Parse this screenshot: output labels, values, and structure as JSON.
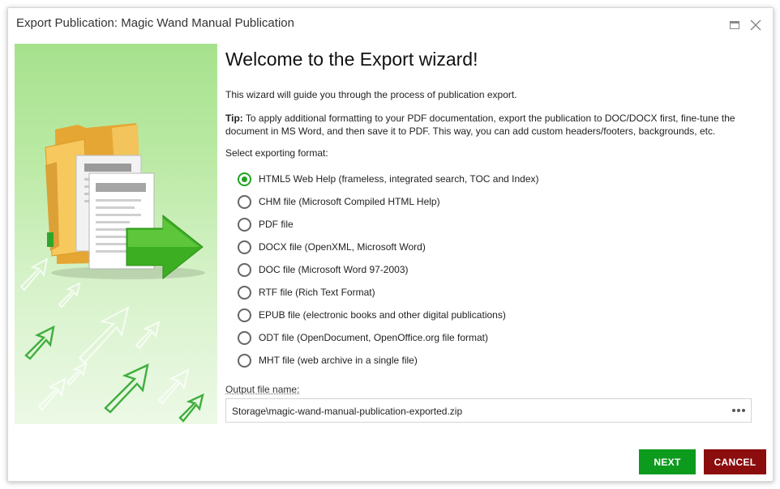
{
  "window": {
    "title": "Export Publication: Magic Wand Manual Publication"
  },
  "icons": {
    "maximize": "maximize-icon",
    "close": "close-icon",
    "browse": "ellipsis-icon",
    "illustration": "folder-export-illustration"
  },
  "wizard": {
    "heading": "Welcome to the Export wizard!",
    "intro": "This wizard will guide you through the process of publication export.",
    "tip_label": "Tip:",
    "tip_text": " To apply additional formatting to your PDF documentation, export the publication to DOC/DOCX first, fine-tune the document in MS Word, and then save it to PDF. This way, you can add custom headers/footers, backgrounds, etc.",
    "format_label": "Select exporting format:",
    "formats": [
      {
        "label": "HTML5 Web Help (frameless, integrated search, TOC and Index)",
        "selected": true
      },
      {
        "label": "CHM file (Microsoft Compiled HTML Help)",
        "selected": false
      },
      {
        "label": "PDF file",
        "selected": false
      },
      {
        "label": "DOCX file (OpenXML, Microsoft Word)",
        "selected": false
      },
      {
        "label": "DOC file (Microsoft Word 97-2003)",
        "selected": false
      },
      {
        "label": "RTF file (Rich Text Format)",
        "selected": false
      },
      {
        "label": "EPUB file (electronic books and other digital publications)",
        "selected": false
      },
      {
        "label": "ODT file (OpenDocument, OpenOffice.org file format)",
        "selected": false
      },
      {
        "label": "MHT file (web archive in a single file)",
        "selected": false
      }
    ],
    "output_label": "Output file name:",
    "output_value": "Storage\\magic-wand-manual-publication-exported.zip"
  },
  "buttons": {
    "next": "NEXT",
    "cancel": "CANCEL"
  },
  "colors": {
    "selected_radio": "#21a321",
    "next_button": "#0d9b1e",
    "cancel_button": "#8b0d0d",
    "side_panel": "#a6e28e"
  }
}
